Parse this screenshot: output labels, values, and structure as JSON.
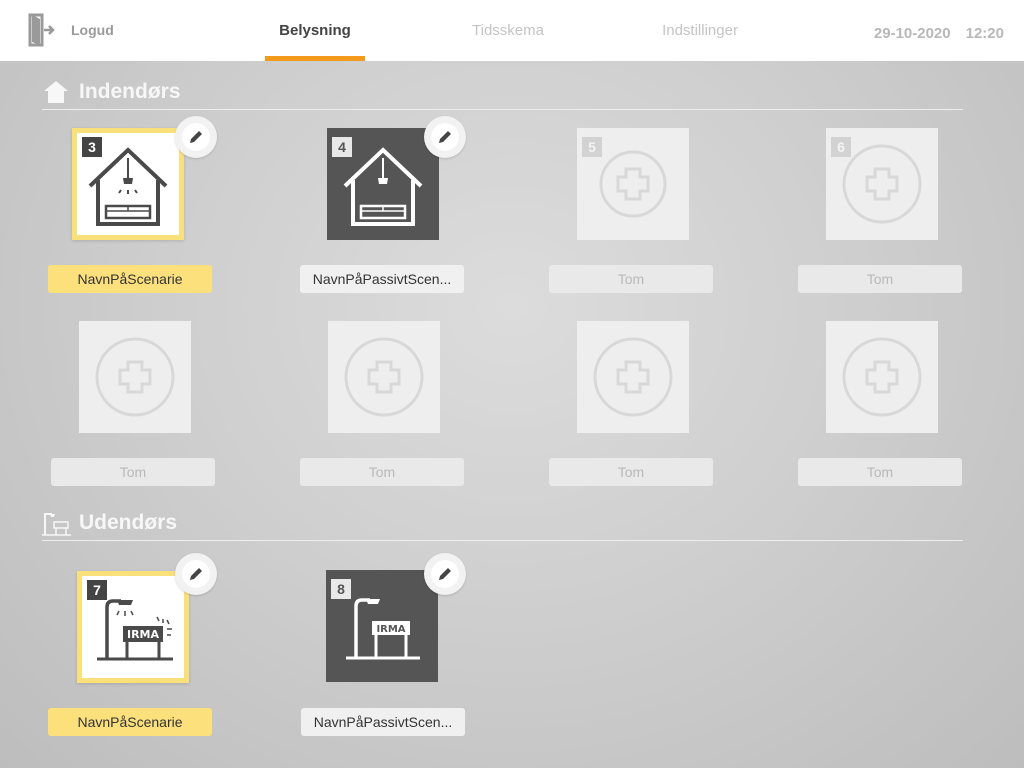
{
  "header": {
    "logout_label": "Logud",
    "tabs": [
      {
        "label": "Belysning",
        "active": true
      },
      {
        "label": "Tidsskema",
        "active": false
      },
      {
        "label": "Indstillinger",
        "active": false
      }
    ],
    "date": "29-10-2020",
    "time": "12:20"
  },
  "indoor": {
    "title": "Indendørs",
    "icon": "house-icon",
    "tiles": [
      {
        "number": "3",
        "label": "NavnPåScenarie",
        "state": "active",
        "icon": "house-lamp-icon"
      },
      {
        "number": "4",
        "label": "NavnPåPassivtScen...",
        "state": "passive",
        "icon": "house-lamp-icon"
      },
      {
        "number": "5",
        "label": "Tom",
        "state": "empty",
        "icon": "plus-circle-icon"
      },
      {
        "number": "6",
        "label": "Tom",
        "state": "empty",
        "icon": "plus-circle-icon"
      },
      {
        "number": "",
        "label": "Tom",
        "state": "empty",
        "icon": "plus-circle-icon"
      },
      {
        "number": "",
        "label": "Tom",
        "state": "empty",
        "icon": "plus-circle-icon"
      },
      {
        "number": "",
        "label": "Tom",
        "state": "empty",
        "icon": "plus-circle-icon"
      },
      {
        "number": "",
        "label": "Tom",
        "state": "empty",
        "icon": "plus-circle-icon"
      }
    ]
  },
  "outdoor": {
    "title": "Udendørs",
    "icon": "streetlamp-icon",
    "tiles": [
      {
        "number": "7",
        "label": "NavnPåScenarie",
        "state": "active",
        "icon": "streetlamp-sign-icon"
      },
      {
        "number": "8",
        "label": "NavnPåPassivtScen...",
        "state": "passive",
        "icon": "streetlamp-sign-icon"
      }
    ]
  },
  "colors": {
    "accent": "#f39a1c",
    "active_label": "#fbe07c",
    "dark_tile": "#555555"
  }
}
